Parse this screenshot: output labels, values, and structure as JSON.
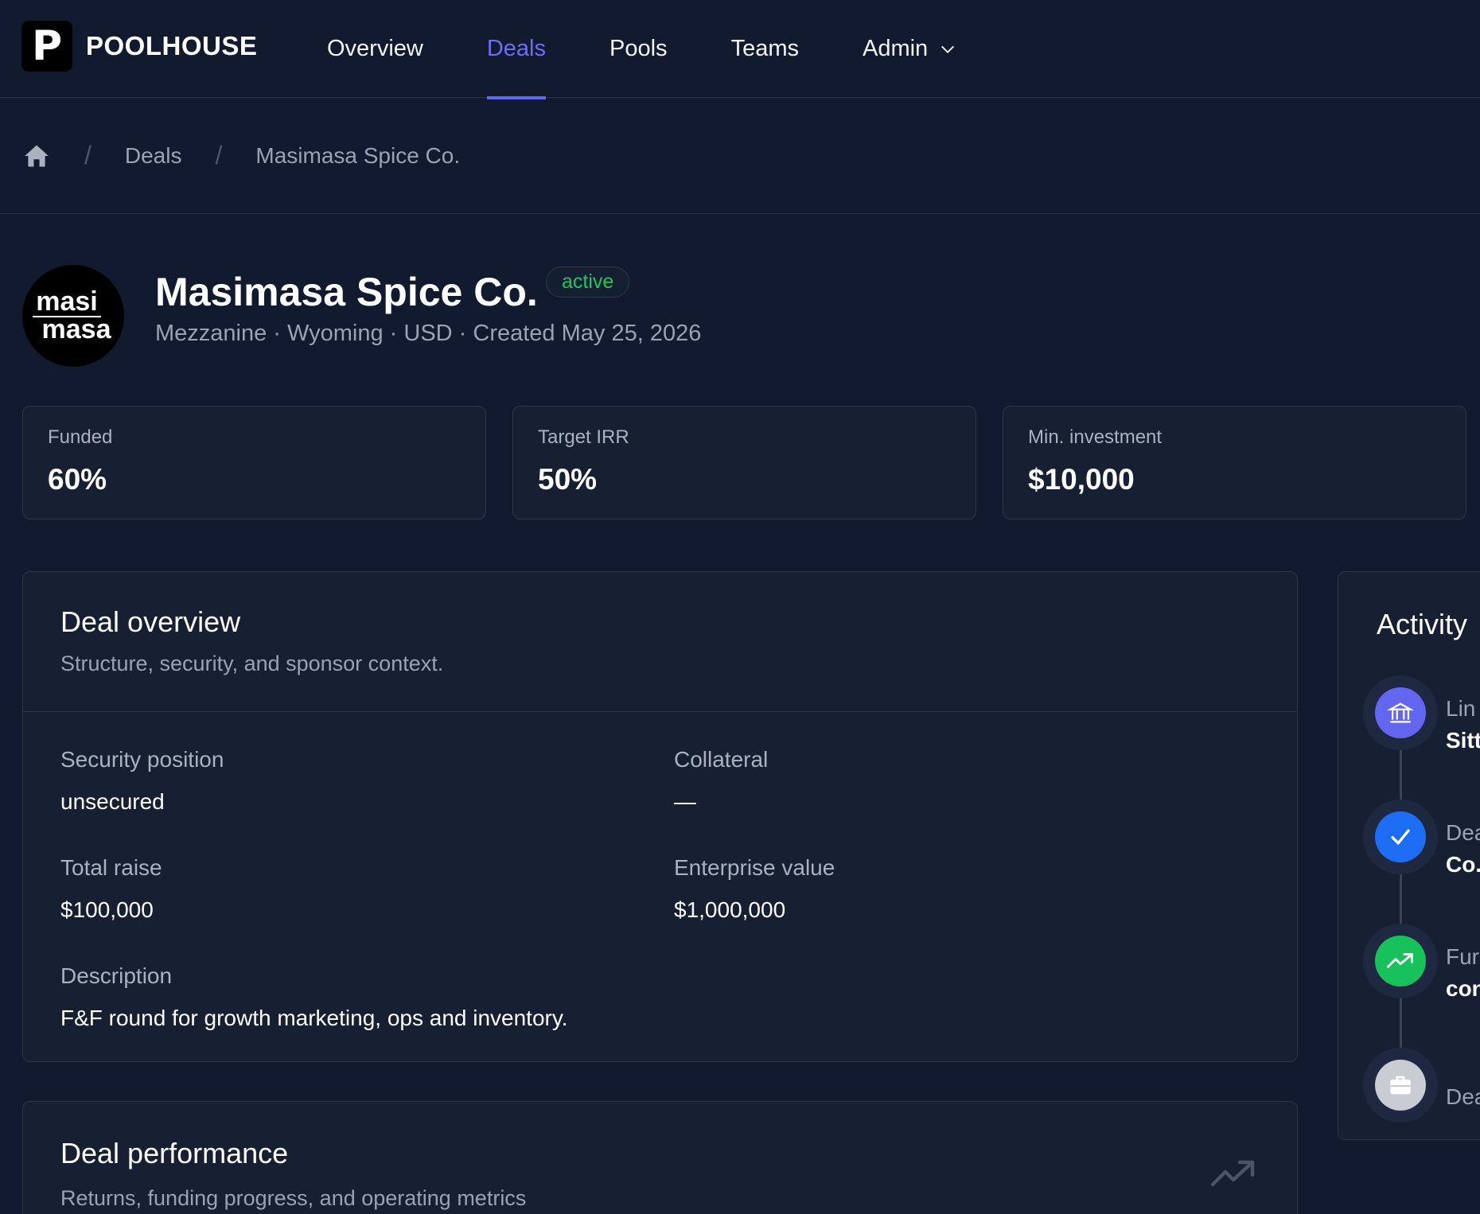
{
  "brand": {
    "logo_letter": "P",
    "name": "POOLHOUSE"
  },
  "nav": {
    "items": [
      {
        "label": "Overview"
      },
      {
        "label": "Deals"
      },
      {
        "label": "Pools"
      },
      {
        "label": "Teams"
      },
      {
        "label": "Admin"
      }
    ],
    "active": "Deals"
  },
  "breadcrumb": {
    "home_icon": "home-icon",
    "separator": "/",
    "items": [
      "Deals",
      "Masimasa Spice Co."
    ]
  },
  "deal": {
    "logo_line1": "masi",
    "logo_line2": "masa",
    "title": "Masimasa Spice Co.",
    "status": "active",
    "meta": "Mezzanine · Wyoming · USD · Created May 25, 2026"
  },
  "stats": [
    {
      "label": "Funded",
      "value": "60%"
    },
    {
      "label": "Target IRR",
      "value": "50%"
    },
    {
      "label": "Min. investment",
      "value": "$10,000"
    }
  ],
  "overview": {
    "title": "Deal overview",
    "subtitle": "Structure, security, and sponsor context.",
    "fields": {
      "security_position": {
        "label": "Security position",
        "value": "unsecured"
      },
      "collateral": {
        "label": "Collateral",
        "value": "—"
      },
      "total_raise": {
        "label": "Total raise",
        "value": "$100,000"
      },
      "enterprise_value": {
        "label": "Enterprise value",
        "value": "$1,000,000"
      },
      "description": {
        "label": "Description",
        "value": "F&F round for growth marketing, ops and inventory."
      }
    }
  },
  "performance": {
    "title": "Deal performance",
    "subtitle": "Returns, funding progress, and operating metrics",
    "icon": "trending-up-icon"
  },
  "activity": {
    "title": "Activity",
    "items": [
      {
        "icon": "bank-icon",
        "color": "#6366f1",
        "line1": "Lin",
        "line2": "Sitt"
      },
      {
        "icon": "check-icon",
        "color": "#1d6ef5",
        "line1": "Dea",
        "line2": "Co."
      },
      {
        "icon": "trending-up-icon",
        "color": "#18c25a",
        "line1": "Fur",
        "line2": "con"
      },
      {
        "icon": "briefcase-icon",
        "color": "#c9ccd3",
        "line1": "Dea",
        "line2": ""
      }
    ]
  },
  "colors": {
    "background": "#111a2e",
    "card": "#172033",
    "accent": "#6366f1",
    "status_active": "#22c55e"
  }
}
